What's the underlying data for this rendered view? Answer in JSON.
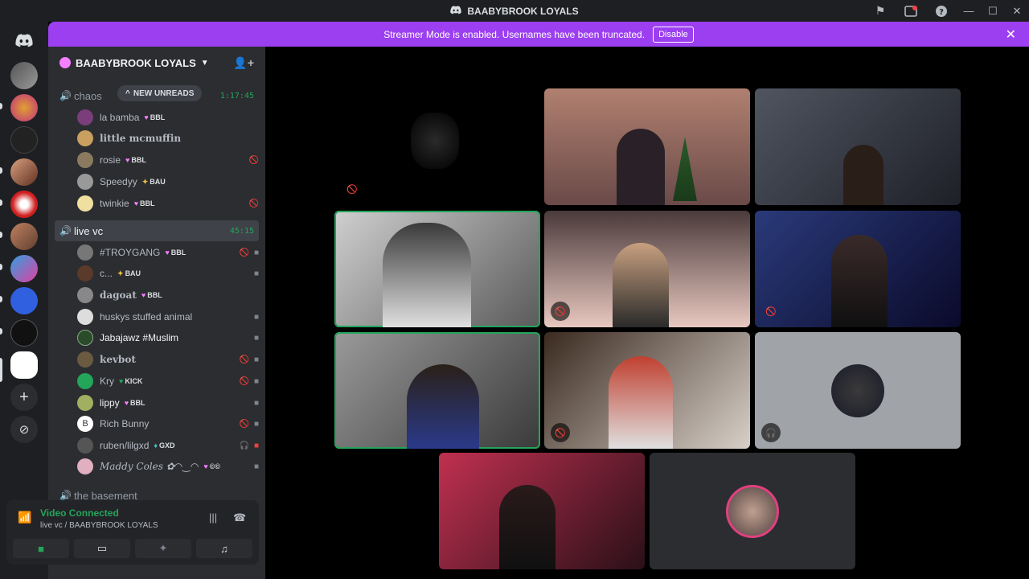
{
  "titlebar": {
    "title": "BAABYBROOK LOYALS"
  },
  "banner": {
    "message": "Streamer Mode is enabled. Usernames have been truncated.",
    "button": "Disable"
  },
  "server": {
    "name": "BAABYBROOK LOYALS"
  },
  "unreads_label": "NEW UNREADS",
  "channels": {
    "chaos": {
      "name": "chaos",
      "timer": "1:17:45"
    },
    "live": {
      "name": "live vc",
      "timer": "45:15"
    },
    "basement": {
      "name": "the basement"
    }
  },
  "chaos_users": [
    {
      "name": "la bamba",
      "tag": "BBL"
    },
    {
      "name": "little mcmuffin",
      "tag": ""
    },
    {
      "name": "rosie",
      "tag": "BBL"
    },
    {
      "name": "Speedyy",
      "tag": "BAU"
    },
    {
      "name": "twinkie",
      "tag": "BBL"
    }
  ],
  "live_users": [
    {
      "name": "#TROYGANG",
      "tag": "BBL"
    },
    {
      "name": "c...",
      "tag": "BAU"
    },
    {
      "name": "dagoat",
      "tag": "BBL"
    },
    {
      "name": "huskys stuffed animal",
      "tag": ""
    },
    {
      "name": "Jabajawz #Muslim",
      "tag": ""
    },
    {
      "name": "kevbot",
      "tag": ""
    },
    {
      "name": "Kry",
      "tag": "KICK"
    },
    {
      "name": "lippy",
      "tag": "BBL"
    },
    {
      "name": "Rich Bunny",
      "tag": ""
    },
    {
      "name": "ruben/lilgxd",
      "tag": "GXD"
    },
    {
      "name": "Maddy Coles ✿◠‿◠",
      "tag": ""
    }
  ],
  "voice": {
    "status": "Video Connected",
    "location": "live vc / BAABYBROOK LOYALS"
  },
  "colors": {
    "accent": "#9c3ff0",
    "connected": "#23a55a",
    "sidebar": "#2b2d31",
    "rail": "#1e1f22"
  }
}
